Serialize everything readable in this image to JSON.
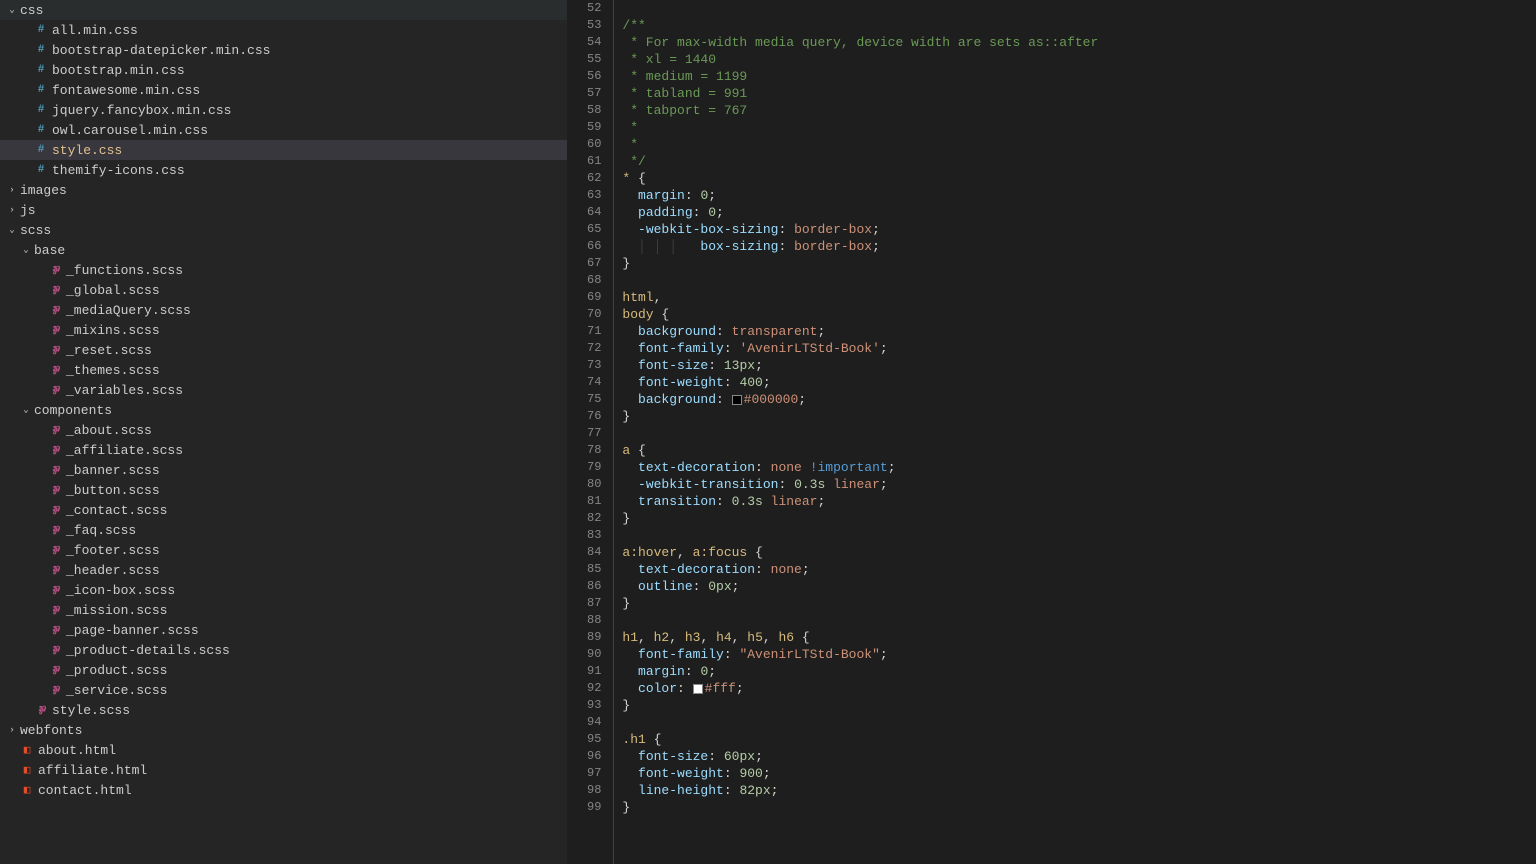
{
  "sidebar": {
    "items": [
      {
        "indent": 0,
        "chevron": "down",
        "icon": "folder",
        "label": "css"
      },
      {
        "indent": 1,
        "chevron": "",
        "icon": "hash",
        "label": "all.min.css"
      },
      {
        "indent": 1,
        "chevron": "",
        "icon": "hash",
        "label": "bootstrap-datepicker.min.css"
      },
      {
        "indent": 1,
        "chevron": "",
        "icon": "hash",
        "label": "bootstrap.min.css"
      },
      {
        "indent": 1,
        "chevron": "",
        "icon": "hash",
        "label": "fontawesome.min.css"
      },
      {
        "indent": 1,
        "chevron": "",
        "icon": "hash",
        "label": "jquery.fancybox.min.css"
      },
      {
        "indent": 1,
        "chevron": "",
        "icon": "hash",
        "label": "owl.carousel.min.css"
      },
      {
        "indent": 1,
        "chevron": "",
        "icon": "hash",
        "label": "style.css",
        "selected": true
      },
      {
        "indent": 1,
        "chevron": "",
        "icon": "hash",
        "label": "themify-icons.css"
      },
      {
        "indent": 0,
        "chevron": "right",
        "icon": "folder",
        "label": "images"
      },
      {
        "indent": 0,
        "chevron": "right",
        "icon": "folder",
        "label": "js"
      },
      {
        "indent": 0,
        "chevron": "down",
        "icon": "folder",
        "label": "scss"
      },
      {
        "indent": 1,
        "chevron": "down",
        "icon": "folder",
        "label": "base"
      },
      {
        "indent": 2,
        "chevron": "",
        "icon": "sass",
        "label": "_functions.scss"
      },
      {
        "indent": 2,
        "chevron": "",
        "icon": "sass",
        "label": "_global.scss"
      },
      {
        "indent": 2,
        "chevron": "",
        "icon": "sass",
        "label": "_mediaQuery.scss"
      },
      {
        "indent": 2,
        "chevron": "",
        "icon": "sass",
        "label": "_mixins.scss"
      },
      {
        "indent": 2,
        "chevron": "",
        "icon": "sass",
        "label": "_reset.scss"
      },
      {
        "indent": 2,
        "chevron": "",
        "icon": "sass",
        "label": "_themes.scss"
      },
      {
        "indent": 2,
        "chevron": "",
        "icon": "sass",
        "label": "_variables.scss"
      },
      {
        "indent": 1,
        "chevron": "down",
        "icon": "folder",
        "label": "components"
      },
      {
        "indent": 2,
        "chevron": "",
        "icon": "sass",
        "label": "_about.scss"
      },
      {
        "indent": 2,
        "chevron": "",
        "icon": "sass",
        "label": "_affiliate.scss"
      },
      {
        "indent": 2,
        "chevron": "",
        "icon": "sass",
        "label": "_banner.scss"
      },
      {
        "indent": 2,
        "chevron": "",
        "icon": "sass",
        "label": "_button.scss"
      },
      {
        "indent": 2,
        "chevron": "",
        "icon": "sass",
        "label": "_contact.scss"
      },
      {
        "indent": 2,
        "chevron": "",
        "icon": "sass",
        "label": "_faq.scss"
      },
      {
        "indent": 2,
        "chevron": "",
        "icon": "sass",
        "label": "_footer.scss"
      },
      {
        "indent": 2,
        "chevron": "",
        "icon": "sass",
        "label": "_header.scss"
      },
      {
        "indent": 2,
        "chevron": "",
        "icon": "sass",
        "label": "_icon-box.scss"
      },
      {
        "indent": 2,
        "chevron": "",
        "icon": "sass",
        "label": "_mission.scss"
      },
      {
        "indent": 2,
        "chevron": "",
        "icon": "sass",
        "label": "_page-banner.scss"
      },
      {
        "indent": 2,
        "chevron": "",
        "icon": "sass",
        "label": "_product-details.scss"
      },
      {
        "indent": 2,
        "chevron": "",
        "icon": "sass",
        "label": "_product.scss"
      },
      {
        "indent": 2,
        "chevron": "",
        "icon": "sass",
        "label": "_service.scss"
      },
      {
        "indent": 1,
        "chevron": "",
        "icon": "sass",
        "label": "style.scss"
      },
      {
        "indent": 0,
        "chevron": "right",
        "icon": "folder",
        "label": "webfonts"
      },
      {
        "indent": 0,
        "chevron": "",
        "icon": "html",
        "label": "about.html"
      },
      {
        "indent": 0,
        "chevron": "",
        "icon": "html",
        "label": "affiliate.html"
      },
      {
        "indent": 0,
        "chevron": "",
        "icon": "html",
        "label": "contact.html"
      }
    ]
  },
  "editor": {
    "lines": [
      {
        "n": 52,
        "t": [
          {
            "c": "cm",
            "s": ""
          }
        ]
      },
      {
        "n": 53,
        "t": [
          {
            "c": "cm",
            "s": "/**"
          }
        ]
      },
      {
        "n": 54,
        "t": [
          {
            "c": "cm",
            "s": " * For max-width media query, device width are sets as::after"
          }
        ]
      },
      {
        "n": 55,
        "t": [
          {
            "c": "cm",
            "s": " * xl = 1440"
          }
        ]
      },
      {
        "n": 56,
        "t": [
          {
            "c": "cm",
            "s": " * medium = 1199"
          }
        ]
      },
      {
        "n": 57,
        "t": [
          {
            "c": "cm",
            "s": " * tabland = 991"
          }
        ]
      },
      {
        "n": 58,
        "t": [
          {
            "c": "cm",
            "s": " * tabport = 767"
          }
        ]
      },
      {
        "n": 59,
        "t": [
          {
            "c": "cm",
            "s": " *"
          }
        ]
      },
      {
        "n": 60,
        "t": [
          {
            "c": "cm",
            "s": " *"
          }
        ]
      },
      {
        "n": 61,
        "t": [
          {
            "c": "cm",
            "s": " */"
          }
        ]
      },
      {
        "n": 62,
        "t": [
          {
            "c": "sel",
            "s": "* "
          },
          {
            "c": "pn",
            "s": "{"
          }
        ]
      },
      {
        "n": 63,
        "t": [
          {
            "c": "pn",
            "s": "  "
          },
          {
            "c": "prop",
            "s": "margin"
          },
          {
            "c": "pn",
            "s": ": "
          },
          {
            "c": "num",
            "s": "0"
          },
          {
            "c": "pn",
            "s": ";"
          }
        ]
      },
      {
        "n": 64,
        "t": [
          {
            "c": "pn",
            "s": "  "
          },
          {
            "c": "prop",
            "s": "padding"
          },
          {
            "c": "pn",
            "s": ": "
          },
          {
            "c": "num",
            "s": "0"
          },
          {
            "c": "pn",
            "s": ";"
          }
        ]
      },
      {
        "n": 65,
        "t": [
          {
            "c": "pn",
            "s": "  "
          },
          {
            "c": "prop",
            "s": "-webkit-box-sizing"
          },
          {
            "c": "pn",
            "s": ": "
          },
          {
            "c": "val",
            "s": "border-box"
          },
          {
            "c": "pn",
            "s": ";"
          }
        ]
      },
      {
        "n": 66,
        "t": [
          {
            "c": "indent-guide",
            "s": "  │ │ │ "
          },
          {
            "c": "prop",
            "s": "  box-sizing"
          },
          {
            "c": "pn",
            "s": ": "
          },
          {
            "c": "val",
            "s": "border-box"
          },
          {
            "c": "pn",
            "s": ";"
          }
        ]
      },
      {
        "n": 67,
        "t": [
          {
            "c": "pn",
            "s": "}"
          }
        ]
      },
      {
        "n": 68,
        "t": []
      },
      {
        "n": 69,
        "t": [
          {
            "c": "sel",
            "s": "html"
          },
          {
            "c": "pn",
            "s": ","
          }
        ]
      },
      {
        "n": 70,
        "t": [
          {
            "c": "sel",
            "s": "body "
          },
          {
            "c": "pn",
            "s": "{"
          }
        ]
      },
      {
        "n": 71,
        "t": [
          {
            "c": "pn",
            "s": "  "
          },
          {
            "c": "prop",
            "s": "background"
          },
          {
            "c": "pn",
            "s": ": "
          },
          {
            "c": "val",
            "s": "transparent"
          },
          {
            "c": "pn",
            "s": ";"
          }
        ]
      },
      {
        "n": 72,
        "t": [
          {
            "c": "pn",
            "s": "  "
          },
          {
            "c": "prop",
            "s": "font-family"
          },
          {
            "c": "pn",
            "s": ": "
          },
          {
            "c": "val",
            "s": "'AvenirLTStd-Book'"
          },
          {
            "c": "pn",
            "s": ";"
          }
        ]
      },
      {
        "n": 73,
        "t": [
          {
            "c": "pn",
            "s": "  "
          },
          {
            "c": "prop",
            "s": "font-size"
          },
          {
            "c": "pn",
            "s": ": "
          },
          {
            "c": "num",
            "s": "13px"
          },
          {
            "c": "pn",
            "s": ";"
          }
        ]
      },
      {
        "n": 74,
        "t": [
          {
            "c": "pn",
            "s": "  "
          },
          {
            "c": "prop",
            "s": "font-weight"
          },
          {
            "c": "pn",
            "s": ": "
          },
          {
            "c": "num",
            "s": "400"
          },
          {
            "c": "pn",
            "s": ";"
          }
        ]
      },
      {
        "n": 75,
        "t": [
          {
            "c": "pn",
            "s": "  "
          },
          {
            "c": "prop",
            "s": "background"
          },
          {
            "c": "pn",
            "s": ": "
          },
          {
            "c": "colorbox cb-black",
            "s": ""
          },
          {
            "c": "val",
            "s": "#000000"
          },
          {
            "c": "pn",
            "s": ";"
          }
        ]
      },
      {
        "n": 76,
        "t": [
          {
            "c": "pn",
            "s": "}"
          }
        ]
      },
      {
        "n": 77,
        "t": []
      },
      {
        "n": 78,
        "t": [
          {
            "c": "sel",
            "s": "a "
          },
          {
            "c": "pn",
            "s": "{"
          }
        ]
      },
      {
        "n": 79,
        "t": [
          {
            "c": "pn",
            "s": "  "
          },
          {
            "c": "prop",
            "s": "text-decoration"
          },
          {
            "c": "pn",
            "s": ": "
          },
          {
            "c": "val",
            "s": "none"
          },
          {
            "c": "pn",
            "s": " "
          },
          {
            "c": "imp",
            "s": "!important"
          },
          {
            "c": "pn",
            "s": ";"
          }
        ]
      },
      {
        "n": 80,
        "t": [
          {
            "c": "pn",
            "s": "  "
          },
          {
            "c": "prop",
            "s": "-webkit-transition"
          },
          {
            "c": "pn",
            "s": ": "
          },
          {
            "c": "num",
            "s": "0.3s"
          },
          {
            "c": "pn",
            "s": " "
          },
          {
            "c": "val",
            "s": "linear"
          },
          {
            "c": "pn",
            "s": ";"
          }
        ]
      },
      {
        "n": 81,
        "t": [
          {
            "c": "pn",
            "s": "  "
          },
          {
            "c": "prop",
            "s": "transition"
          },
          {
            "c": "pn",
            "s": ": "
          },
          {
            "c": "num",
            "s": "0.3s"
          },
          {
            "c": "pn",
            "s": " "
          },
          {
            "c": "val",
            "s": "linear"
          },
          {
            "c": "pn",
            "s": ";"
          }
        ]
      },
      {
        "n": 82,
        "t": [
          {
            "c": "pn",
            "s": "}"
          }
        ]
      },
      {
        "n": 83,
        "t": []
      },
      {
        "n": 84,
        "t": [
          {
            "c": "sel",
            "s": "a:hover"
          },
          {
            "c": "pn",
            "s": ", "
          },
          {
            "c": "sel",
            "s": "a:focus "
          },
          {
            "c": "pn",
            "s": "{"
          }
        ]
      },
      {
        "n": 85,
        "t": [
          {
            "c": "pn",
            "s": "  "
          },
          {
            "c": "prop",
            "s": "text-decoration"
          },
          {
            "c": "pn",
            "s": ": "
          },
          {
            "c": "val",
            "s": "none"
          },
          {
            "c": "pn",
            "s": ";"
          }
        ]
      },
      {
        "n": 86,
        "t": [
          {
            "c": "pn",
            "s": "  "
          },
          {
            "c": "prop",
            "s": "outline"
          },
          {
            "c": "pn",
            "s": ": "
          },
          {
            "c": "num",
            "s": "0px"
          },
          {
            "c": "pn",
            "s": ";"
          }
        ]
      },
      {
        "n": 87,
        "t": [
          {
            "c": "pn",
            "s": "}"
          }
        ]
      },
      {
        "n": 88,
        "t": []
      },
      {
        "n": 89,
        "t": [
          {
            "c": "sel",
            "s": "h1"
          },
          {
            "c": "pn",
            "s": ", "
          },
          {
            "c": "sel",
            "s": "h2"
          },
          {
            "c": "pn",
            "s": ", "
          },
          {
            "c": "sel",
            "s": "h3"
          },
          {
            "c": "pn",
            "s": ", "
          },
          {
            "c": "sel",
            "s": "h4"
          },
          {
            "c": "pn",
            "s": ", "
          },
          {
            "c": "sel",
            "s": "h5"
          },
          {
            "c": "pn",
            "s": ", "
          },
          {
            "c": "sel",
            "s": "h6 "
          },
          {
            "c": "pn",
            "s": "{"
          }
        ]
      },
      {
        "n": 90,
        "t": [
          {
            "c": "pn",
            "s": "  "
          },
          {
            "c": "prop",
            "s": "font-family"
          },
          {
            "c": "pn",
            "s": ": "
          },
          {
            "c": "val",
            "s": "\"AvenirLTStd-Book\""
          },
          {
            "c": "pn",
            "s": ";"
          }
        ]
      },
      {
        "n": 91,
        "t": [
          {
            "c": "pn",
            "s": "  "
          },
          {
            "c": "prop",
            "s": "margin"
          },
          {
            "c": "pn",
            "s": ": "
          },
          {
            "c": "num",
            "s": "0"
          },
          {
            "c": "pn",
            "s": ";"
          }
        ]
      },
      {
        "n": 92,
        "t": [
          {
            "c": "pn",
            "s": "  "
          },
          {
            "c": "prop",
            "s": "color"
          },
          {
            "c": "pn",
            "s": ": "
          },
          {
            "c": "colorbox cb-white",
            "s": ""
          },
          {
            "c": "val",
            "s": "#fff"
          },
          {
            "c": "pn",
            "s": ";"
          }
        ]
      },
      {
        "n": 93,
        "t": [
          {
            "c": "pn",
            "s": "}"
          }
        ]
      },
      {
        "n": 94,
        "t": []
      },
      {
        "n": 95,
        "t": [
          {
            "c": "sel",
            "s": ".h1 "
          },
          {
            "c": "pn",
            "s": "{"
          }
        ]
      },
      {
        "n": 96,
        "t": [
          {
            "c": "pn",
            "s": "  "
          },
          {
            "c": "prop",
            "s": "font-size"
          },
          {
            "c": "pn",
            "s": ": "
          },
          {
            "c": "num",
            "s": "60px"
          },
          {
            "c": "pn",
            "s": ";"
          }
        ]
      },
      {
        "n": 97,
        "t": [
          {
            "c": "pn",
            "s": "  "
          },
          {
            "c": "prop",
            "s": "font-weight"
          },
          {
            "c": "pn",
            "s": ": "
          },
          {
            "c": "num",
            "s": "900"
          },
          {
            "c": "pn",
            "s": ";"
          }
        ]
      },
      {
        "n": 98,
        "t": [
          {
            "c": "pn",
            "s": "  "
          },
          {
            "c": "prop",
            "s": "line-height"
          },
          {
            "c": "pn",
            "s": ": "
          },
          {
            "c": "num",
            "s": "82px"
          },
          {
            "c": "pn",
            "s": ";"
          }
        ]
      },
      {
        "n": 99,
        "t": [
          {
            "c": "pn",
            "s": "}"
          }
        ]
      }
    ]
  }
}
